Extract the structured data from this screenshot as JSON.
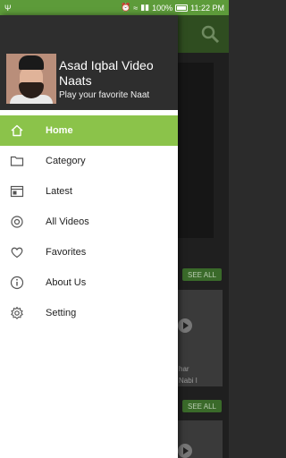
{
  "status_bar": {
    "left_icon": "usb-icon",
    "battery": "100%",
    "time": "11:22 PM",
    "icons": [
      "alarm-icon",
      "wifi-icon",
      "signal-icon"
    ]
  },
  "background": {
    "see_all_1": "SEE ALL",
    "see_all_2": "SEE ALL",
    "snippet_1": "har",
    "snippet_2": "Nabi I"
  },
  "drawer": {
    "title": "Asad Iqbal Video Naats",
    "subtitle": "Play your favorite Naat",
    "items": [
      {
        "label": "Home",
        "icon": "home-icon",
        "active": true
      },
      {
        "label": "Category",
        "icon": "folder-icon"
      },
      {
        "label": "Latest",
        "icon": "latest-icon"
      },
      {
        "label": "All Videos",
        "icon": "video-icon"
      },
      {
        "label": "Favorites",
        "icon": "heart-icon"
      },
      {
        "label": "About Us",
        "icon": "info-icon"
      },
      {
        "label": "Setting",
        "icon": "gear-icon"
      }
    ]
  },
  "colors": {
    "accent": "#8bc34a",
    "status_bar": "#5d9b3a",
    "header": "#2e2e2e"
  }
}
